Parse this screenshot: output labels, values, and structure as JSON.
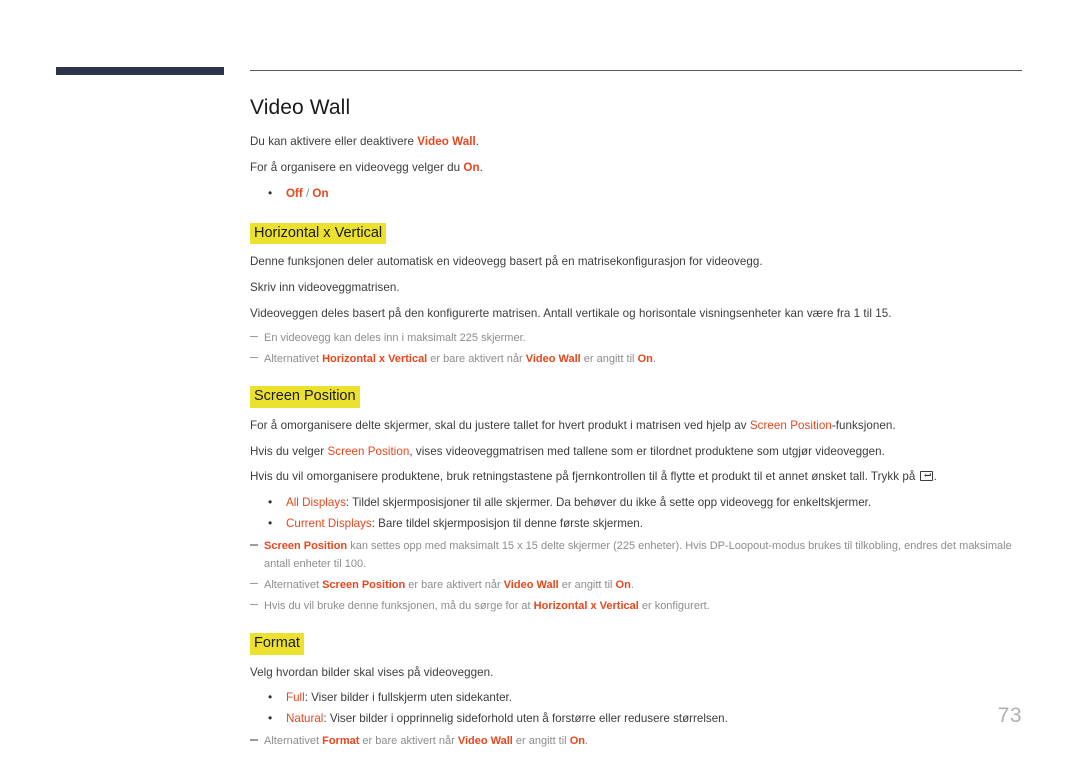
{
  "page": {
    "number": "73",
    "accent_color": "#e8461c",
    "highlight_color": "#ece12f",
    "rule_color": "#56566e",
    "margin_bar_color": "#2d3349",
    "note_color": "#8d8d8d"
  },
  "title": "Video Wall",
  "intro": {
    "line1_a": "Du kan aktivere eller deaktivere ",
    "line1_em": "Video Wall",
    "line1_b": ".",
    "line2_a": "For å organisere en videovegg velger du ",
    "line2_em": "On",
    "line2_b": ".",
    "bullet_off": "Off",
    "bullet_sep": " / ",
    "bullet_on": "On"
  },
  "sections": [
    {
      "heading": "Horizontal x Vertical",
      "paragraphs": [
        "Denne funksjonen deler automatisk en videovegg basert på en matrisekonfigurasjon for videovegg.",
        "Skriv inn videoveggmatrisen.",
        "Videoveggen deles basert på den konfigurerte matrisen. Antall vertikale og horisontale visningsenheter kan være fra 1 til 15."
      ],
      "notes": [
        {
          "plain": "En videovegg kan deles inn i maksimalt 225 skjermer."
        },
        {
          "a": "Alternativet ",
          "em1": "Horizontal x Vertical",
          "b": " er bare aktivert når ",
          "em2": "Video Wall",
          "c": " er angitt til ",
          "em3": "On",
          "d": "."
        }
      ]
    },
    {
      "heading": "Screen Position",
      "paragraphs_rich": [
        {
          "a": "For å omorganisere delte skjermer, skal du justere tallet for hvert produkt i matrisen ved hjelp av ",
          "em1": "Screen Position",
          "b": "-funksjonen."
        },
        {
          "a": "Hvis du velger ",
          "em1": "Screen Position",
          "b": ", vises videoveggmatrisen med tallene som er tilordnet produktene som utgjør videoveggen."
        },
        {
          "a": "Hvis du vil omorganisere produktene, bruk retningstastene på fjernkontrollen til å flytte et produkt til et annet ønsket tall. Trykk på ",
          "icon": "enter-key-icon",
          "b": "."
        }
      ],
      "bullets": [
        {
          "em": "All Displays",
          "text": ": Tildel skjermposisjoner til alle skjermer. Da behøver du ikke å sette opp videovegg for enkeltskjermer."
        },
        {
          "em": "Current Displays",
          "text": ": Bare tildel skjermposisjon til denne første skjermen."
        }
      ],
      "notes": [
        {
          "em_lead": "Screen Position",
          "a": " kan settes opp med maksimalt 15 x 15 delte skjermer (225 enheter). Hvis DP-Loopout-modus brukes til tilkobling, endres det maksimale",
          "sub": "antall enheter til 100."
        },
        {
          "a": "Alternativet ",
          "em1": "Screen Position",
          "b": " er bare aktivert når ",
          "em2": "Video Wall",
          "c": " er angitt til ",
          "em3": "On",
          "d": "."
        },
        {
          "a": "Hvis du vil bruke denne funksjonen, må du sørge for at ",
          "em1": "Horizontal x Vertical",
          "b": " er konfigurert."
        }
      ]
    },
    {
      "heading": "Format",
      "paragraphs": [
        "Velg hvordan bilder skal vises på videoveggen."
      ],
      "bullets": [
        {
          "em": "Full",
          "text": ": Viser bilder i fullskjerm uten sidekanter."
        },
        {
          "em": "Natural",
          "text": ": Viser bilder i opprinnelig sideforhold uten å forstørre eller redusere størrelsen."
        }
      ],
      "notes": [
        {
          "a": "Alternativet ",
          "em1": "Format",
          "b": " er bare aktivert når ",
          "em2": "Video Wall",
          "c": " er angitt til ",
          "em3": "On",
          "d": "."
        }
      ]
    }
  ]
}
